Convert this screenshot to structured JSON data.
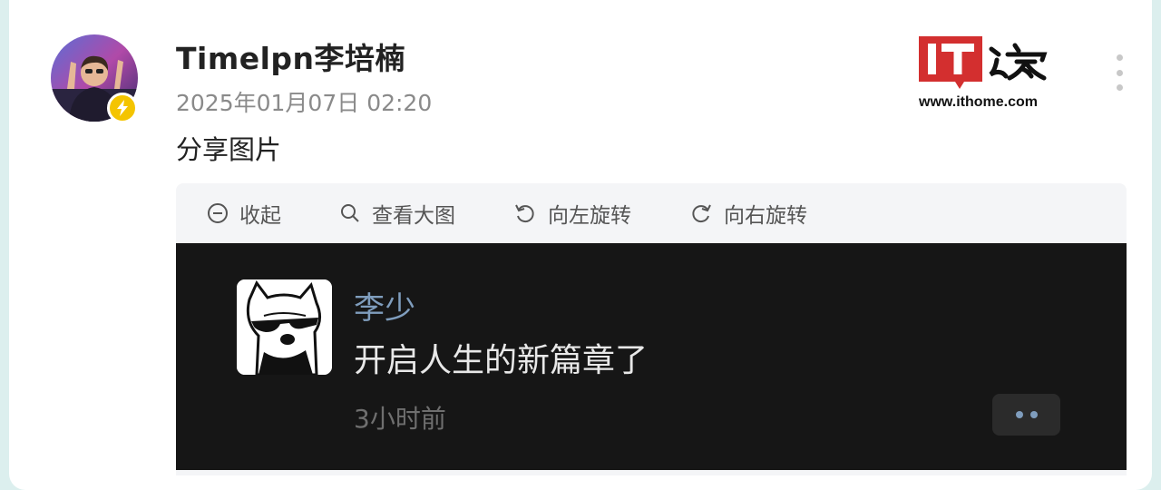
{
  "post": {
    "author": "Timelpn李培楠",
    "timestamp": "2025年01月07日 02:20",
    "text": "分享图片"
  },
  "logo": {
    "brand_text": "IT之家",
    "url": "www.ithome.com"
  },
  "image_viewer": {
    "toolbar": {
      "collapse_label": "收起",
      "view_large_label": "查看大图",
      "rotate_left_label": "向左旋转",
      "rotate_right_label": "向右旋转"
    },
    "screenshot": {
      "name": "李少",
      "message": "开启人生的新篇章了",
      "time": "3小时前"
    }
  },
  "colors": {
    "badge": "#f4c400",
    "logo_red": "#d32f2f",
    "screenshot_bg": "#161616",
    "screenshot_name": "#7f9dbd"
  }
}
